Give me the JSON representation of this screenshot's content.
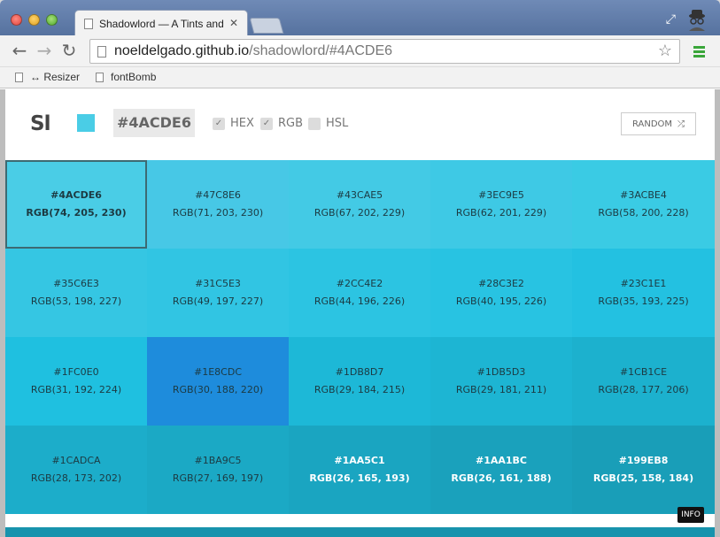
{
  "browser": {
    "tab_title": "Shadowlord — A Tints and",
    "url_host": "noeldelgado.github.io",
    "url_path": "/shadowlord/#4ACDE6",
    "bookmarks": [
      {
        "label": "↔ Resizer"
      },
      {
        "label": "fontBomb"
      }
    ]
  },
  "app": {
    "logo": "Sl",
    "current_color": "#4ACDE6",
    "swatch_color": "#4acde6",
    "options": [
      {
        "label": "HEX",
        "checked": true
      },
      {
        "label": "RGB",
        "checked": true
      },
      {
        "label": "HSL",
        "checked": false
      }
    ],
    "random_label": "RANDOM",
    "info_label": "INFO"
  },
  "colors": [
    {
      "hex": "#4ACDE6",
      "rgb": "RGB(74, 205, 230)"
    },
    {
      "hex": "#47C8E6",
      "rgb": "RGB(71, 203, 230)"
    },
    {
      "hex": "#43CAE5",
      "rgb": "RGB(67, 202, 229)"
    },
    {
      "hex": "#3EC9E5",
      "rgb": "RGB(62, 201, 229)"
    },
    {
      "hex": "#3ACBE4",
      "rgb": "RGB(58, 200, 228)"
    },
    {
      "hex": "#35C6E3",
      "rgb": "RGB(53, 198, 227)"
    },
    {
      "hex": "#31C5E3",
      "rgb": "RGB(49, 197, 227)"
    },
    {
      "hex": "#2CC4E2",
      "rgb": "RGB(44, 196, 226)"
    },
    {
      "hex": "#28C3E2",
      "rgb": "RGB(40, 195, 226)"
    },
    {
      "hex": "#23C1E1",
      "rgb": "RGB(35, 193, 225)"
    },
    {
      "hex": "#1FC0E0",
      "rgb": "RGB(31, 192, 224)"
    },
    {
      "hex": "#1E8CDC",
      "rgb": "RGB(30, 188, 220)"
    },
    {
      "hex": "#1DB8D7",
      "rgb": "RGB(29, 184, 215)"
    },
    {
      "hex": "#1DB5D3",
      "rgb": "RGB(29, 181, 211)"
    },
    {
      "hex": "#1CB1CE",
      "rgb": "RGB(28, 177, 206)"
    },
    {
      "hex": "#1CADCA",
      "rgb": "RGB(28, 173, 202)"
    },
    {
      "hex": "#1BA9C5",
      "rgb": "RGB(27, 169, 197)"
    },
    {
      "hex": "#1AA5C1",
      "rgb": "RGB(26, 165, 193)"
    },
    {
      "hex": "#1AA1BC",
      "rgb": "RGB(26, 161, 188)"
    },
    {
      "hex": "#199EB8",
      "rgb": "RGB(25, 158, 184)"
    }
  ]
}
